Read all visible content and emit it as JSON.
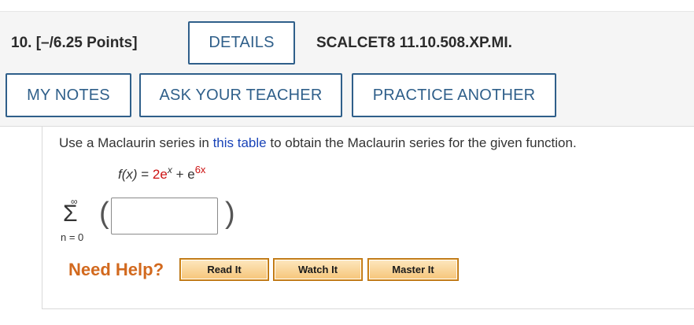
{
  "question": {
    "number_label": "10.",
    "points_label": "[–/6.25 Points]",
    "code": "SCALCET8 11.10.508.XP.MI."
  },
  "buttons": {
    "details": "DETAILS",
    "my_notes": "MY NOTES",
    "ask_teacher": "ASK YOUR TEACHER",
    "practice_another": "PRACTICE ANOTHER"
  },
  "instructions": {
    "before_link": "Use a Maclaurin series in ",
    "link": "this table",
    "after_link": " to obtain the Maclaurin series for the given function."
  },
  "function": {
    "lhs": "f(x)",
    "equals": " = ",
    "coef": "2e",
    "exp1": "x",
    "plus": " + e",
    "exp2": "6x"
  },
  "summation": {
    "upper": "∞",
    "symbol": "Σ",
    "lower": "n = 0",
    "answer_value": ""
  },
  "help": {
    "label": "Need Help?",
    "read_it": "Read It",
    "watch_it": "Watch It",
    "master_it": "Master It"
  },
  "colors": {
    "accent": "#2f5f8a",
    "link": "#1a44b8",
    "need_help": "#d2691e",
    "red_math": "#cc1111"
  }
}
